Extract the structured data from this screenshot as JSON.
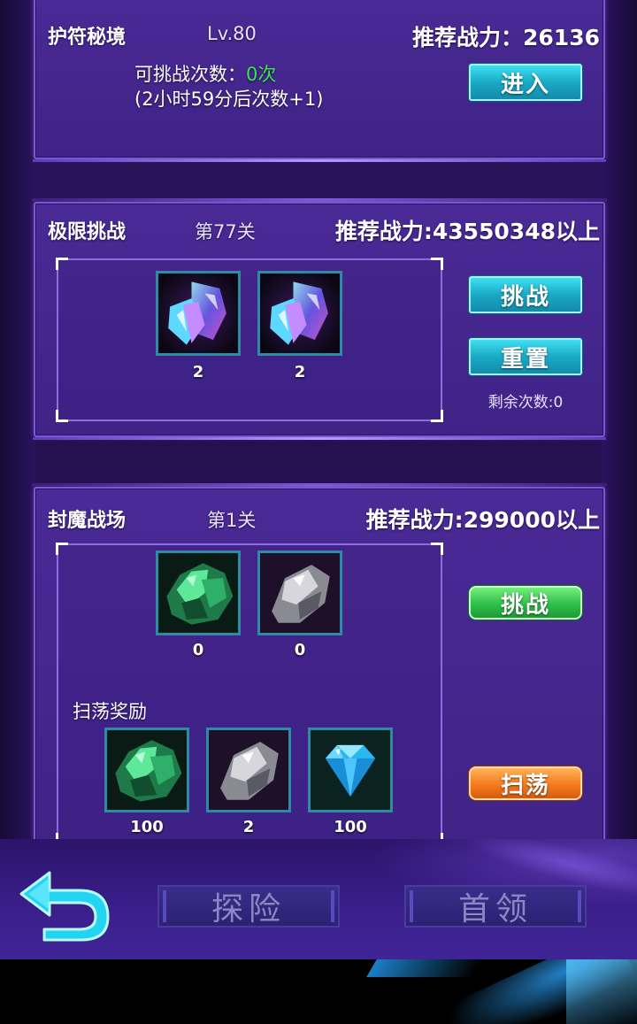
{
  "panel_amulet": {
    "title": "护符秘境",
    "level": "Lv.80",
    "power": "推荐战力：26136",
    "attempts_label": "可挑战次数：",
    "attempts_value": "0次",
    "recover_note": "(2小时59分后次数+1)",
    "enter_label": "进入"
  },
  "panel_limit": {
    "title": "极限挑战",
    "stage": "第77关",
    "power": "推荐战力:43550348以上",
    "rewards": [
      {
        "icon": "blue-crystal-icon",
        "count": "2"
      },
      {
        "icon": "blue-crystal-icon",
        "count": "2"
      }
    ],
    "challenge_label": "挑战",
    "reset_label": "重置",
    "remaining": "剩余次数:0"
  },
  "panel_demon": {
    "title": "封魔战场",
    "stage": "第1关",
    "power": "推荐战力:299000以上",
    "rewards": [
      {
        "icon": "green-ore-icon",
        "count": "0"
      },
      {
        "icon": "silver-ore-icon",
        "count": "0"
      }
    ],
    "sweep_title": "扫荡奖励",
    "sweep_rewards": [
      {
        "icon": "green-ore-icon",
        "count": "100"
      },
      {
        "icon": "silver-ore-icon",
        "count": "2"
      },
      {
        "icon": "diamond-icon",
        "count": "100"
      }
    ],
    "challenge_label": "挑战",
    "sweep_label": "扫荡"
  },
  "bottom": {
    "explore_label": "探险",
    "boss_label": "首领"
  }
}
